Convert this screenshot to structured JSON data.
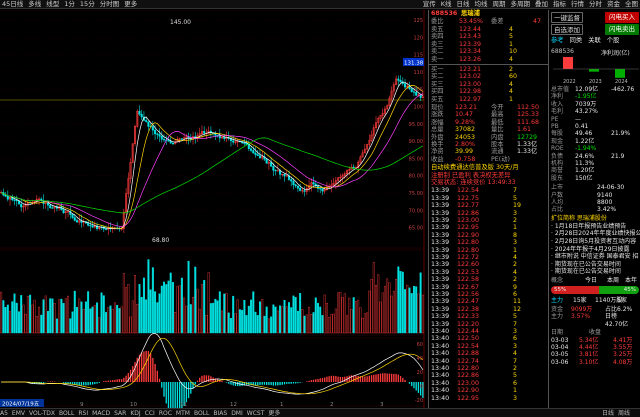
{
  "topbar": {
    "left": [
      "45日线",
      "多线",
      "线型",
      "1分",
      "15分",
      "分时图",
      "更多"
    ],
    "right": [
      "宣传",
      "K线",
      "日线",
      "均线",
      "周期",
      "多周期",
      "叠加",
      "指标",
      "行情",
      "分时",
      "资金",
      "全图"
    ]
  },
  "chart": {
    "price_high": "145.00",
    "price_low": "68.80",
    "current_tag": "131.38",
    "date_tag": "2024/07/19五",
    "axis_labels": [
      "125",
      "120",
      "115",
      "110",
      "105",
      "100",
      "95.00",
      "90.00",
      "85.00",
      "80.00",
      "75.00",
      "70.00",
      "65.00"
    ],
    "indicator_labels": [
      "60",
      "40",
      "20",
      "0",
      "-20"
    ],
    "month_labels": [
      "8",
      "9",
      "10",
      "11",
      "12",
      "1",
      "2",
      "3"
    ],
    "colors": {
      "up": "#ff3b3b",
      "down": "#00e0e0",
      "ma5": "#ffffff",
      "ma10": "#ffd700",
      "ma20": "#ff40ff",
      "ma60": "#00e000"
    }
  },
  "quote": {
    "code": "688536",
    "name": "思瑞浦",
    "weibi_label": "委比",
    "weibi_value": "53.45%",
    "weicha_label": "委差",
    "weicha_value": "47",
    "sell": [
      {
        "label": "卖五",
        "price": "123.44",
        "vol": "4"
      },
      {
        "label": "卖四",
        "price": "123.43",
        "vol": "5"
      },
      {
        "label": "卖三",
        "price": "123.39",
        "vol": "1"
      },
      {
        "label": "卖二",
        "price": "123.34",
        "vol": "10"
      },
      {
        "label": "卖一",
        "price": "123.26",
        "vol": "4"
      }
    ],
    "buy": [
      {
        "label": "买一",
        "price": "123.21",
        "vol": "2"
      },
      {
        "label": "买二",
        "price": "123.02",
        "vol": "60"
      },
      {
        "label": "买三",
        "price": "123.00",
        "vol": "4"
      },
      {
        "label": "买四",
        "price": "122.98",
        "vol": "4"
      },
      {
        "label": "买五",
        "price": "122.97",
        "vol": "1"
      }
    ],
    "stats": [
      {
        "l1": "现价",
        "v1": "123.21",
        "l2": "今开",
        "v2": "112.50"
      },
      {
        "l1": "涨跌",
        "v1": "10.47",
        "l2": "最高",
        "v2": "125.33"
      },
      {
        "l1": "涨幅",
        "v1": "9.28%",
        "l2": "最低",
        "v2": "111.68"
      },
      {
        "l1": "总量",
        "v1": "37082",
        "l2": "量比",
        "v2": "1.61"
      },
      {
        "l1": "外盘",
        "v1": "24053",
        "l2": "内盘",
        "v2": "12729"
      },
      {
        "l1": "换手",
        "v1": "2.80%",
        "l2": "股本",
        "v2": "1.33亿"
      },
      {
        "l1": "净资",
        "v1": "39.99",
        "l2": "流通",
        "v2": "1.33亿"
      },
      {
        "l1": "收益",
        "v1": "-0.758",
        "l2": "PE(动)",
        "v2": ""
      }
    ],
    "notes": [
      "自动续费通达信普及版 30天/月",
      "注册制 已盈利 表决权无差异",
      "交易状态: 连续竞价 13:49:33"
    ],
    "ticks": [
      {
        "t": "13:39",
        "p": "122.54",
        "v": "7"
      },
      {
        "t": "13:39",
        "p": "122.75",
        "v": "5"
      },
      {
        "t": "13:39",
        "p": "122.77",
        "v": "19"
      },
      {
        "t": "13:39",
        "p": "122.86",
        "v": "3"
      },
      {
        "t": "13:39",
        "p": "123.00",
        "v": "2"
      },
      {
        "t": "13:39",
        "p": "122.95",
        "v": "1"
      },
      {
        "t": "13:39",
        "p": "122.90",
        "v": "8"
      },
      {
        "t": "13:39",
        "p": "122.80",
        "v": "3"
      },
      {
        "t": "13:39",
        "p": "122.80",
        "v": "1"
      },
      {
        "t": "13:39",
        "p": "122.72",
        "v": "4"
      },
      {
        "t": "13:39",
        "p": "122.60",
        "v": "2"
      },
      {
        "t": "13:39",
        "p": "122.53",
        "v": "4"
      },
      {
        "t": "13:39",
        "p": "122.58",
        "v": "2"
      },
      {
        "t": "13:39",
        "p": "122.67",
        "v": "9"
      },
      {
        "t": "13:39",
        "p": "122.56",
        "v": "6"
      },
      {
        "t": "13:39",
        "p": "122.47",
        "v": "11"
      },
      {
        "t": "13:39",
        "p": "122.38",
        "v": "12"
      },
      {
        "t": "13:39",
        "p": "122.33",
        "v": "5"
      },
      {
        "t": "13:39",
        "p": "122.20",
        "v": "7"
      },
      {
        "t": "13:40",
        "p": "122.44",
        "v": "3"
      },
      {
        "t": "13:40",
        "p": "122.50",
        "v": "6"
      },
      {
        "t": "13:40",
        "p": "122.54",
        "v": "3"
      },
      {
        "t": "13:40",
        "p": "122.88",
        "v": "4"
      },
      {
        "t": "13:40",
        "p": "122.74",
        "v": "7"
      },
      {
        "t": "13:40",
        "p": "122.80",
        "v": "2"
      },
      {
        "t": "13:40",
        "p": "122.86",
        "v": "5"
      },
      {
        "t": "13:40",
        "p": "123.00",
        "v": "6"
      },
      {
        "t": "13:40",
        "p": "122.90",
        "v": "1"
      },
      {
        "t": "13:40",
        "p": "122.95",
        "v": "3"
      },
      {
        "t": "13:40",
        "p": "123.15",
        "v": "8"
      },
      {
        "t": "13:40",
        "p": "123.08",
        "v": "4"
      },
      {
        "t": "13:40",
        "p": "123.21",
        "v": "2"
      }
    ]
  },
  "right": {
    "buttons": {
      "hk_label": "闪电买入",
      "sell_label": "闪电卖出",
      "one_key": "一键监督",
      "watch": "自选添加"
    },
    "tabs": [
      "参考",
      "同类",
      "关联",
      "个股"
    ],
    "code": "688536",
    "profit_label": "净利润(亿)",
    "bars": [
      {
        "year": "2022",
        "value": 2.67
      },
      {
        "year": "2023",
        "value": -0.59
      },
      {
        "year": "2024",
        "value": -1.96
      }
    ],
    "fin": [
      {
        "k": "总市值",
        "v": "12.09亿"
      },
      {
        "k": "净利",
        "v": "-1.95亿"
      },
      {
        "k": "收入",
        "v": "7039万"
      },
      {
        "k": "毛利",
        "v": "43.27%"
      },
      {
        "k": "PE",
        "v": "—"
      },
      {
        "k": "PB",
        "v": "0.41"
      },
      {
        "k": "每股",
        "v": "49.46"
      },
      {
        "k": "现金",
        "v": "1.22亿"
      },
      {
        "k": "ROE",
        "v": "-1.94%"
      },
      {
        "k": "负债",
        "v": "24.6%"
      },
      {
        "k": "机构",
        "v": "11.3%"
      },
      {
        "k": "商誉",
        "v": "1.20亿"
      },
      {
        "k": "股东",
        "v": "150亿"
      }
    ],
    "fin_right": [
      "-462.76",
      "",
      "",
      "",
      "",
      "",
      "21.9%",
      "",
      "",
      "21.9",
      "",
      "",
      ""
    ],
    "dates": [
      {
        "k": "上市",
        "v": "24-06-30"
      },
      {
        "k": "户数",
        "v": "9140"
      },
      {
        "k": "人均",
        "v": "8800"
      },
      {
        "k": "占比",
        "v": "3.42%"
      }
    ],
    "news_title": "扩位简称 思瑞浦股份",
    "news": [
      "1月18日年报预告业绩预告",
      "2月28日2024年年度业绩快报公告",
      "2月28日询5月投资者互动内容",
      "2024年年报于4月29日披露",
      "继市附说 中信证券 国泰君安 招",
      "期货现在已公告交易时间",
      "期货现在已公告交易时间"
    ],
    "board_row": {
      "a": "概念",
      "b": "今日",
      "c": "本周",
      "d": "本年"
    },
    "vote": {
      "left_label": "55%",
      "right_label": "45%",
      "left_value": 0.55,
      "right_value": 0.45
    },
    "sub_tabs": [
      "主力",
      "15家",
      "1140万股",
      "5家"
    ],
    "money": [
      {
        "k": "资金",
        "v1": "9099万",
        "v2": "占比6.2%"
      },
      {
        "k": "主力",
        "v1": "3.57%",
        "v2": "日榜"
      },
      {
        "k": "",
        "v1": "",
        "v2": "42.70亿"
      }
    ],
    "hist_head": {
      "k": "日期",
      "v": "收盘"
    },
    "hist": [
      {
        "d": "03-03",
        "v": "5.34亿",
        "v2": "4.41万"
      },
      {
        "d": "03-04",
        "v": "4.44亿",
        "v2": "3.55万"
      },
      {
        "d": "03-05",
        "v": "3.81亿",
        "v2": "3.25万"
      },
      {
        "d": "03-06",
        "v": "3.10亿",
        "v2": "4.08万"
      }
    ]
  },
  "bottombar": {
    "items": [
      "A5",
      "EMV",
      "VOL-TDX",
      "BOLL",
      "RSI",
      "MACD",
      "SAR",
      "KDJ",
      "CCI",
      "ROC",
      "MTM",
      "BOLL",
      "BIAS",
      "DMI",
      "WCST",
      "更多"
    ],
    "right": [
      "日线",
      "周线"
    ]
  }
}
